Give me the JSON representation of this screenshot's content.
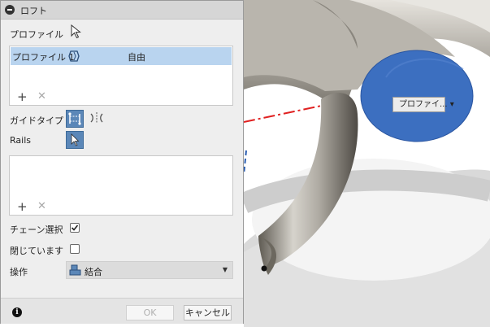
{
  "dialog": {
    "title": "ロフト",
    "profile_label": "プロファイル",
    "profiles": [
      {
        "name": "プロファイル 1",
        "mode": "自由"
      }
    ],
    "add_symbol": "+",
    "remove_symbol": "✕",
    "guide_type_label": "ガイドタイプ",
    "rails_label": "Rails",
    "chain_select_label": "チェーン選択",
    "chain_select_checked": true,
    "closed_label": "閉じています",
    "closed_checked": false,
    "operation_label": "操作",
    "operation_value": "結合",
    "info_symbol": "i",
    "ok_label": "OK",
    "cancel_label": "キャンセル",
    "accent_color": "#5b87b8",
    "selection_color": "#b9d4ef"
  },
  "viewport": {
    "profile_tag": "プロファイ...",
    "profile_face_color": "#3c6fc0",
    "axis_color": "#e02020"
  }
}
